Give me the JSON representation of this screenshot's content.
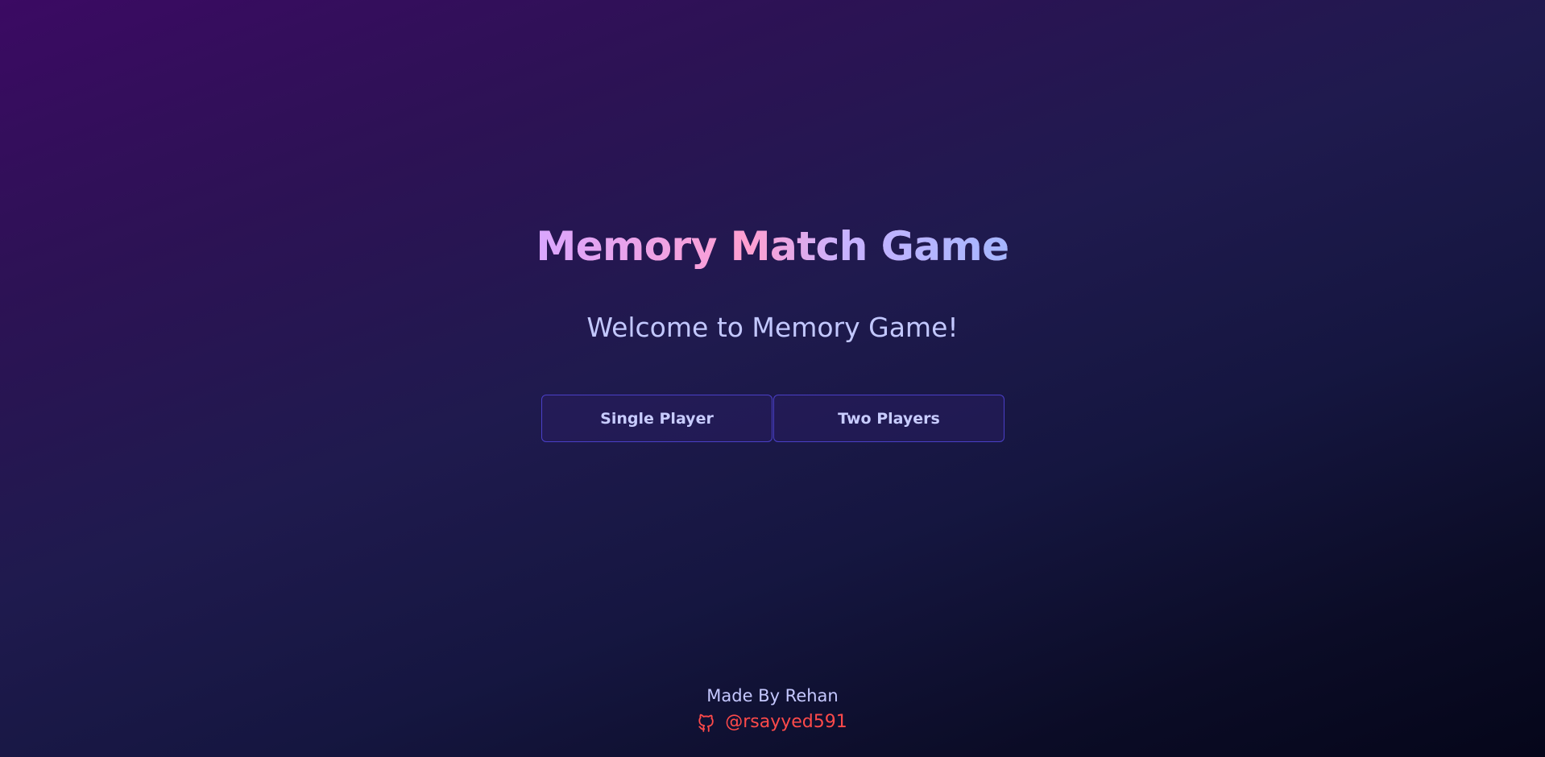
{
  "app": {
    "title": "Memory Match Game",
    "welcome": "Welcome to Memory Game!"
  },
  "modes": {
    "single_player_label": "Single Player",
    "two_players_label": "Two Players"
  },
  "footer": {
    "made_by": "Made By Rehan",
    "github_handle": "@rsayyed591",
    "icon": "github-icon"
  },
  "colors": {
    "accent_border": "#4a3fc7",
    "link": "#ff4a4a",
    "text": "#c3c8ff"
  }
}
